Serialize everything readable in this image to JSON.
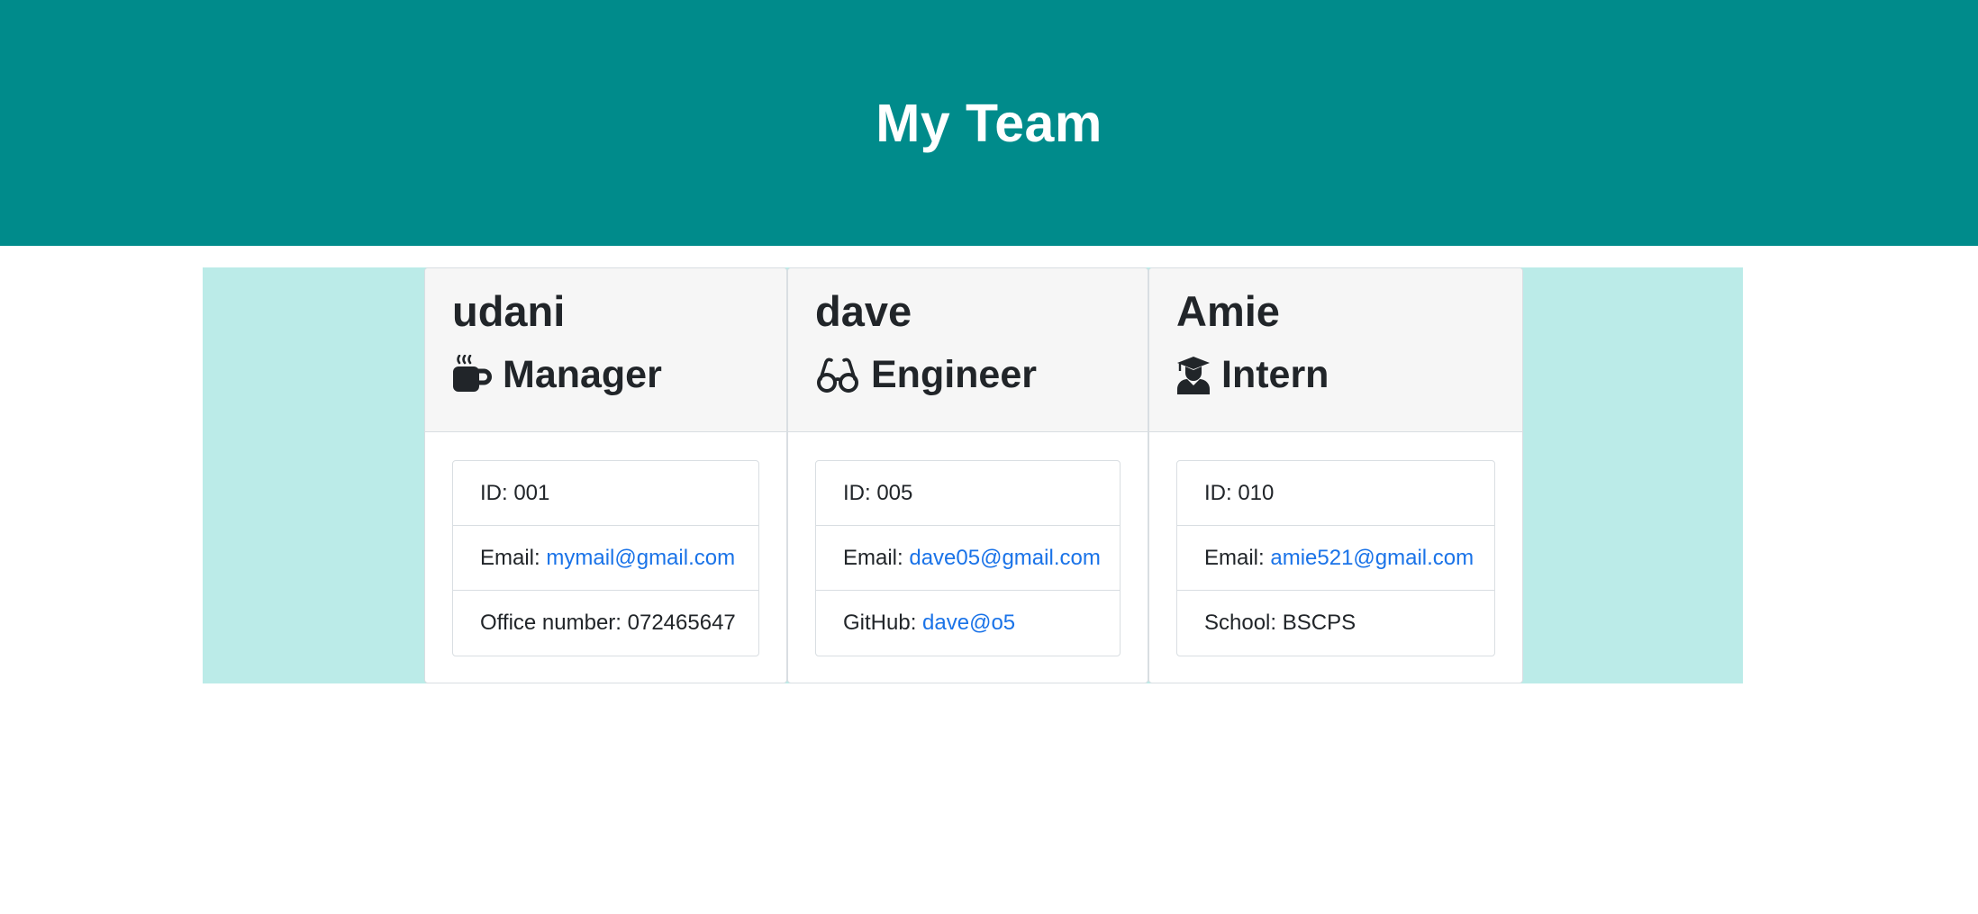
{
  "header": {
    "title": "My Team"
  },
  "team": [
    {
      "name": "udani",
      "role": "Manager",
      "role_icon": "coffee-icon",
      "id_label": "ID: 001",
      "email_label": "Email: ",
      "email": "mymail@gmail.com",
      "extra_label": "Office number: 072465647",
      "extra_link": ""
    },
    {
      "name": "dave",
      "role": "Engineer",
      "role_icon": "glasses-icon",
      "id_label": "ID: 005",
      "email_label": "Email: ",
      "email": "dave05@gmail.com",
      "extra_label": "GitHub: ",
      "extra_link": "dave@o5"
    },
    {
      "name": "Amie",
      "role": "Intern",
      "role_icon": "graduate-icon",
      "id_label": "ID: 010",
      "email_label": "Email: ",
      "email": "amie521@gmail.com",
      "extra_label": "School: BSCPS",
      "extra_link": ""
    }
  ],
  "colors": {
    "header_bg": "#008b8b",
    "band_bg": "#bbebe8",
    "card_head_bg": "#f6f6f6",
    "link": "#1a73e8"
  }
}
